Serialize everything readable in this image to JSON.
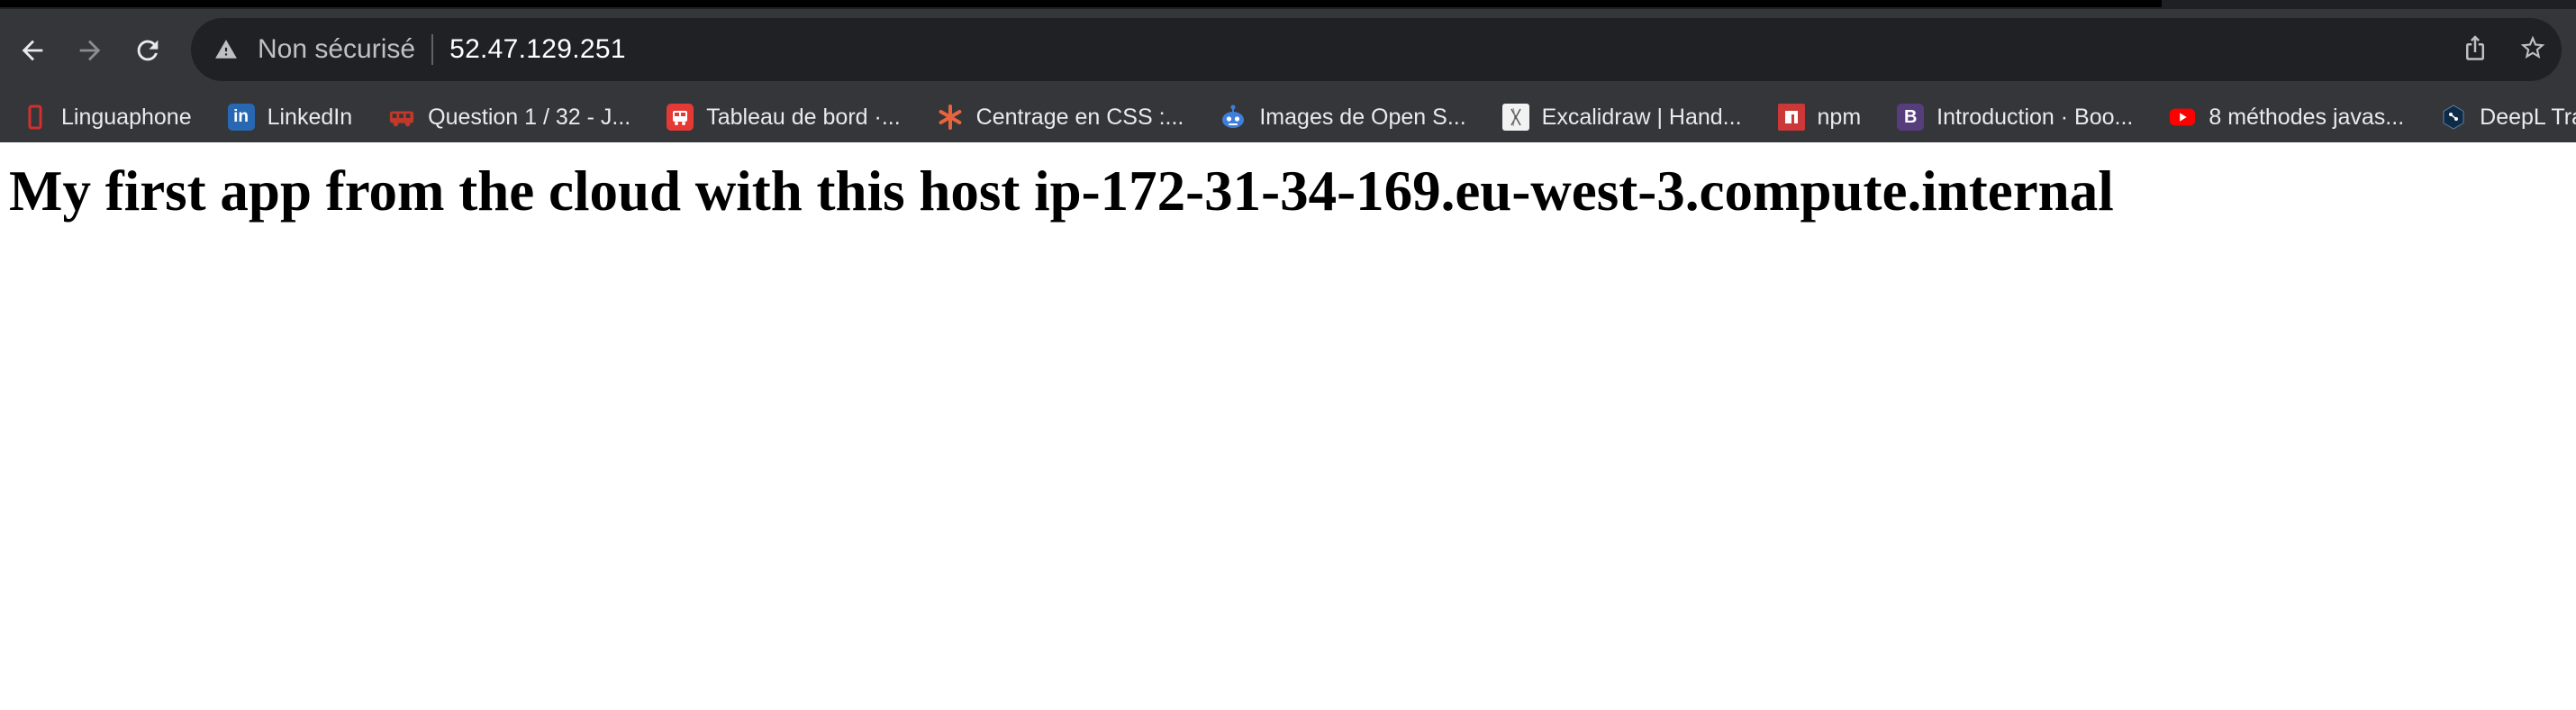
{
  "browser": {
    "nav": {
      "back_icon": "arrow-left-icon",
      "forward_icon": "arrow-right-icon",
      "reload_icon": "reload-icon"
    },
    "omnibox": {
      "security_icon": "warning-triangle-icon",
      "security_label": "Non sécurisé",
      "url": "52.47.129.251",
      "share_icon": "share-icon",
      "bookmark_icon": "star-icon"
    },
    "bookmarks": [
      {
        "label": "Linguaphone",
        "icon": "linguaphone-icon",
        "color": "#c62828"
      },
      {
        "label": "LinkedIn",
        "icon": "linkedin-icon",
        "color": "#2867b2"
      },
      {
        "label": "Question 1 / 32 - J...",
        "icon": "bus-icon",
        "color": "#c0392b"
      },
      {
        "label": "Tableau de bord ·...",
        "icon": "bus-icon",
        "color": "#e53935"
      },
      {
        "label": "Centrage en CSS :...",
        "icon": "asterisk-icon",
        "color": "#e8643c"
      },
      {
        "label": "Images de Open S...",
        "icon": "robot-icon",
        "color": "#3f7fd9"
      },
      {
        "label": "Excalidraw | Hand...",
        "icon": "excalidraw-icon",
        "color": "#f2f2f2"
      },
      {
        "label": "npm",
        "icon": "npm-icon",
        "color": "#cb3837"
      },
      {
        "label": "Introduction · Boo...",
        "icon": "bootstrap-icon",
        "color": "#563d7c"
      },
      {
        "label": "8 méthodes javas...",
        "icon": "youtube-icon",
        "color": "#ff0000"
      },
      {
        "label": "DeepL Tradu",
        "icon": "deepl-icon",
        "color": "#0f2b46"
      }
    ]
  },
  "page": {
    "heading": "My first app from the cloud with this host ip-172-31-34-169.eu-west-3.compute.internal"
  }
}
